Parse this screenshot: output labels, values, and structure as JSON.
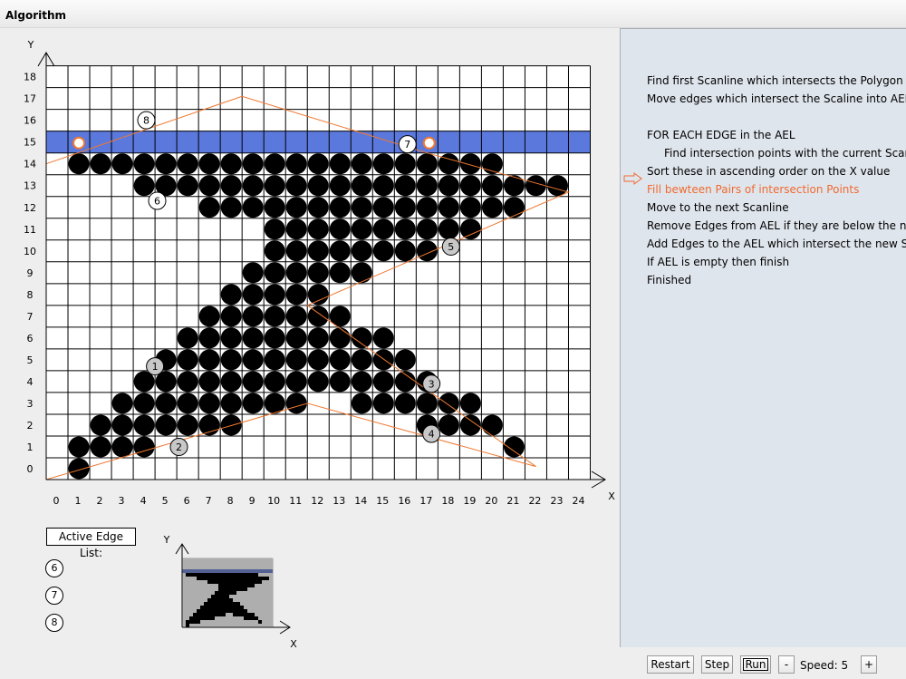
{
  "window": {
    "title": "Algorithm"
  },
  "grid": {
    "x_ticks": [
      "0",
      "1",
      "2",
      "3",
      "4",
      "5",
      "6",
      "7",
      "8",
      "9",
      "10",
      "11",
      "12",
      "13",
      "14",
      "15",
      "16",
      "17",
      "18",
      "19",
      "20",
      "21",
      "22",
      "23",
      "24"
    ],
    "y_ticks": [
      "0",
      "1",
      "2",
      "3",
      "4",
      "5",
      "6",
      "7",
      "8",
      "9",
      "10",
      "11",
      "12",
      "13",
      "14",
      "15",
      "16",
      "17",
      "18"
    ],
    "x_axis_label": "X",
    "y_axis_label": "Y",
    "scanline_y": 15,
    "scanline_color": "#5b78dc",
    "polygon_color": "#f07830",
    "polygon_vertices": [
      [
        0,
        14.5
      ],
      [
        9,
        17.6
      ],
      [
        17.5,
        15
      ],
      [
        24,
        13.2
      ],
      [
        12,
        8
      ],
      [
        22.5,
        0.6
      ],
      [
        12,
        3.5
      ],
      [
        0,
        0
      ]
    ],
    "filled_cells": {
      "14": [
        1,
        2,
        3,
        4,
        5,
        6,
        7,
        8,
        9,
        10,
        11,
        12,
        13,
        14,
        15,
        16,
        17,
        18,
        19,
        20
      ],
      "13": [
        4,
        5,
        6,
        7,
        8,
        9,
        10,
        11,
        12,
        13,
        14,
        15,
        16,
        17,
        18,
        19,
        20,
        21,
        22,
        23
      ],
      "12": [
        7,
        8,
        9,
        10,
        11,
        12,
        13,
        14,
        15,
        16,
        17,
        18,
        19,
        20,
        21
      ],
      "11": [
        10,
        11,
        12,
        13,
        14,
        15,
        16,
        17,
        18,
        19
      ],
      "10": [
        10,
        11,
        12,
        13,
        14,
        15,
        16,
        17
      ],
      "9": [
        9,
        10,
        11,
        12,
        13,
        14
      ],
      "8": [
        8,
        9,
        10,
        11,
        12
      ],
      "7": [
        7,
        8,
        9,
        10,
        11,
        12,
        13
      ],
      "6": [
        6,
        7,
        8,
        9,
        10,
        11,
        12,
        13,
        14,
        15
      ],
      "5": [
        5,
        6,
        7,
        8,
        9,
        10,
        11,
        12,
        13,
        14,
        15,
        16
      ],
      "4": [
        4,
        5,
        6,
        7,
        8,
        9,
        10,
        11,
        12,
        13,
        14,
        15,
        16,
        17
      ],
      "3": [
        3,
        4,
        5,
        6,
        7,
        8,
        9,
        10,
        11,
        14,
        15,
        16,
        17,
        18,
        19
      ],
      "2": [
        2,
        3,
        4,
        5,
        6,
        7,
        8,
        17,
        18,
        19,
        20
      ],
      "1": [
        1,
        2,
        3,
        4,
        21
      ],
      "0": [
        1
      ]
    },
    "edge_labels": [
      {
        "label": "1",
        "x": 5,
        "y": 5.2,
        "style": "grey"
      },
      {
        "label": "2",
        "x": 6.1,
        "y": 1.5,
        "style": "grey"
      },
      {
        "label": "3",
        "x": 17.7,
        "y": 4.4,
        "style": "grey"
      },
      {
        "label": "4",
        "x": 17.7,
        "y": 2.1,
        "style": "grey"
      },
      {
        "label": "5",
        "x": 18.6,
        "y": 10.7,
        "style": "grey"
      },
      {
        "label": "6",
        "x": 5.1,
        "y": 12.8,
        "style": "white"
      },
      {
        "label": "7",
        "x": 16.6,
        "y": 15.4,
        "style": "white"
      },
      {
        "label": "8",
        "x": 4.6,
        "y": 16.5,
        "style": "white"
      }
    ],
    "intersections": [
      [
        1.5,
        15
      ],
      [
        17.6,
        15
      ]
    ]
  },
  "ael": {
    "title": "Active Edge List:",
    "items": [
      "6",
      "7",
      "8"
    ]
  },
  "thumbnail": {
    "x_label": "X",
    "y_label": "Y"
  },
  "steps": [
    {
      "text": "Find first Scanline which intersects the Polygon",
      "indent": false,
      "active": false
    },
    {
      "text": "Move edges which intersect the Scaline into AEL",
      "indent": false,
      "active": false
    },
    {
      "text": "",
      "indent": false,
      "active": false
    },
    {
      "text": "FOR EACH EDGE in the AEL",
      "indent": false,
      "active": false
    },
    {
      "text": "Find intersection points with the current Scanline",
      "indent": true,
      "active": false
    },
    {
      "text": "Sort these in ascending order on the X value",
      "indent": false,
      "active": false
    },
    {
      "text": "Fill bewteen Pairs of intersection Points",
      "indent": false,
      "active": true
    },
    {
      "text": "Move to the next Scanline",
      "indent": false,
      "active": false
    },
    {
      "text": "Remove Edges from AEL if they are below the new Scanline",
      "indent": false,
      "active": false
    },
    {
      "text": "Add Edges to the AEL which intersect the new Scanline",
      "indent": false,
      "active": false
    },
    {
      "text": "If AEL is empty then finish",
      "indent": false,
      "active": false
    },
    {
      "text": "Finished",
      "indent": false,
      "active": false
    }
  ],
  "controls": {
    "restart": "Restart",
    "step": "Step",
    "run": "Run",
    "minus": "-",
    "speed_label": "Speed:",
    "speed_value": "5",
    "plus": "+"
  }
}
